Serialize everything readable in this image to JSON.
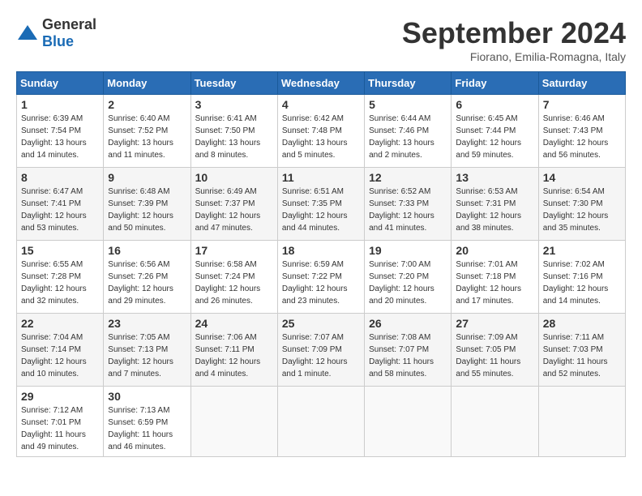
{
  "logo": {
    "general": "General",
    "blue": "Blue"
  },
  "title": "September 2024",
  "location": "Fiorano, Emilia-Romagna, Italy",
  "days_of_week": [
    "Sunday",
    "Monday",
    "Tuesday",
    "Wednesday",
    "Thursday",
    "Friday",
    "Saturday"
  ],
  "weeks": [
    [
      {
        "day": "1",
        "sunrise": "6:39 AM",
        "sunset": "7:54 PM",
        "daylight": "13 hours and 14 minutes."
      },
      {
        "day": "2",
        "sunrise": "6:40 AM",
        "sunset": "7:52 PM",
        "daylight": "13 hours and 11 minutes."
      },
      {
        "day": "3",
        "sunrise": "6:41 AM",
        "sunset": "7:50 PM",
        "daylight": "13 hours and 8 minutes."
      },
      {
        "day": "4",
        "sunrise": "6:42 AM",
        "sunset": "7:48 PM",
        "daylight": "13 hours and 5 minutes."
      },
      {
        "day": "5",
        "sunrise": "6:44 AM",
        "sunset": "7:46 PM",
        "daylight": "13 hours and 2 minutes."
      },
      {
        "day": "6",
        "sunrise": "6:45 AM",
        "sunset": "7:44 PM",
        "daylight": "12 hours and 59 minutes."
      },
      {
        "day": "7",
        "sunrise": "6:46 AM",
        "sunset": "7:43 PM",
        "daylight": "12 hours and 56 minutes."
      }
    ],
    [
      {
        "day": "8",
        "sunrise": "6:47 AM",
        "sunset": "7:41 PM",
        "daylight": "12 hours and 53 minutes."
      },
      {
        "day": "9",
        "sunrise": "6:48 AM",
        "sunset": "7:39 PM",
        "daylight": "12 hours and 50 minutes."
      },
      {
        "day": "10",
        "sunrise": "6:49 AM",
        "sunset": "7:37 PM",
        "daylight": "12 hours and 47 minutes."
      },
      {
        "day": "11",
        "sunrise": "6:51 AM",
        "sunset": "7:35 PM",
        "daylight": "12 hours and 44 minutes."
      },
      {
        "day": "12",
        "sunrise": "6:52 AM",
        "sunset": "7:33 PM",
        "daylight": "12 hours and 41 minutes."
      },
      {
        "day": "13",
        "sunrise": "6:53 AM",
        "sunset": "7:31 PM",
        "daylight": "12 hours and 38 minutes."
      },
      {
        "day": "14",
        "sunrise": "6:54 AM",
        "sunset": "7:30 PM",
        "daylight": "12 hours and 35 minutes."
      }
    ],
    [
      {
        "day": "15",
        "sunrise": "6:55 AM",
        "sunset": "7:28 PM",
        "daylight": "12 hours and 32 minutes."
      },
      {
        "day": "16",
        "sunrise": "6:56 AM",
        "sunset": "7:26 PM",
        "daylight": "12 hours and 29 minutes."
      },
      {
        "day": "17",
        "sunrise": "6:58 AM",
        "sunset": "7:24 PM",
        "daylight": "12 hours and 26 minutes."
      },
      {
        "day": "18",
        "sunrise": "6:59 AM",
        "sunset": "7:22 PM",
        "daylight": "12 hours and 23 minutes."
      },
      {
        "day": "19",
        "sunrise": "7:00 AM",
        "sunset": "7:20 PM",
        "daylight": "12 hours and 20 minutes."
      },
      {
        "day": "20",
        "sunrise": "7:01 AM",
        "sunset": "7:18 PM",
        "daylight": "12 hours and 17 minutes."
      },
      {
        "day": "21",
        "sunrise": "7:02 AM",
        "sunset": "7:16 PM",
        "daylight": "12 hours and 14 minutes."
      }
    ],
    [
      {
        "day": "22",
        "sunrise": "7:04 AM",
        "sunset": "7:14 PM",
        "daylight": "12 hours and 10 minutes."
      },
      {
        "day": "23",
        "sunrise": "7:05 AM",
        "sunset": "7:13 PM",
        "daylight": "12 hours and 7 minutes."
      },
      {
        "day": "24",
        "sunrise": "7:06 AM",
        "sunset": "7:11 PM",
        "daylight": "12 hours and 4 minutes."
      },
      {
        "day": "25",
        "sunrise": "7:07 AM",
        "sunset": "7:09 PM",
        "daylight": "12 hours and 1 minute."
      },
      {
        "day": "26",
        "sunrise": "7:08 AM",
        "sunset": "7:07 PM",
        "daylight": "11 hours and 58 minutes."
      },
      {
        "day": "27",
        "sunrise": "7:09 AM",
        "sunset": "7:05 PM",
        "daylight": "11 hours and 55 minutes."
      },
      {
        "day": "28",
        "sunrise": "7:11 AM",
        "sunset": "7:03 PM",
        "daylight": "11 hours and 52 minutes."
      }
    ],
    [
      {
        "day": "29",
        "sunrise": "7:12 AM",
        "sunset": "7:01 PM",
        "daylight": "11 hours and 49 minutes."
      },
      {
        "day": "30",
        "sunrise": "7:13 AM",
        "sunset": "6:59 PM",
        "daylight": "11 hours and 46 minutes."
      },
      null,
      null,
      null,
      null,
      null
    ]
  ]
}
